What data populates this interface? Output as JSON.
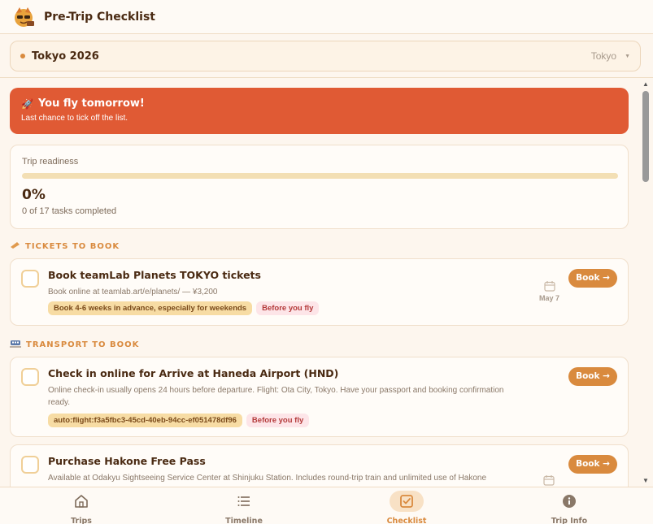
{
  "app": {
    "title": "Pre-Trip Checklist"
  },
  "trip": {
    "name": "Tokyo 2026",
    "city": "Tokyo"
  },
  "banner": {
    "title": "You fly tomorrow!",
    "subtitle": "Last chance to tick off the list."
  },
  "readiness": {
    "label": "Trip readiness",
    "percent_label": "0%",
    "progress": 0,
    "count_text": "0 of 17 tasks completed"
  },
  "sections": [
    {
      "title": "TICKETS TO BOOK",
      "icon": "ticket-icon",
      "tasks": [
        {
          "title": "Book teamLab Planets TOKYO tickets",
          "description": "Book online at teamlab.art/e/planets/ — ¥3,200",
          "note_tag": "Book 4-6 weeks in advance, especially for weekends",
          "when_tag": "Before you fly",
          "date": "May 7",
          "action": "Book →"
        }
      ]
    },
    {
      "title": "TRANSPORT TO BOOK",
      "icon": "train-icon",
      "tasks": [
        {
          "title": "Check in online for Arrive at Haneda Airport (HND)",
          "description_line1": "Online check-in usually opens 24 hours before departure. Flight: Ota City, Tokyo. Have your passport and booking confirmation",
          "description_line2": "ready.",
          "note_tag": "auto:flight:f3a5fbc3-45cd-40eb-94cc-ef051478df96",
          "when_tag": "Before you fly",
          "action": "Book →"
        },
        {
          "title": "Purchase Hakone Free Pass",
          "description": "Available at Odakyu Sightseeing Service Center at Shinjuku Station. Includes round-trip train and unlimited use of Hakone",
          "action": "Book →"
        }
      ]
    }
  ],
  "nav": {
    "items": [
      {
        "label": "Trips",
        "icon": "home-icon"
      },
      {
        "label": "Timeline",
        "icon": "list-icon"
      },
      {
        "label": "Checklist",
        "icon": "checkbox-icon"
      },
      {
        "label": "Trip Info",
        "icon": "info-icon"
      }
    ],
    "active": "Checklist"
  },
  "colors": {
    "accent": "#d98a3e",
    "banner": "#e05a34",
    "background": "#fdf6ee",
    "text": "#4a2a12"
  }
}
